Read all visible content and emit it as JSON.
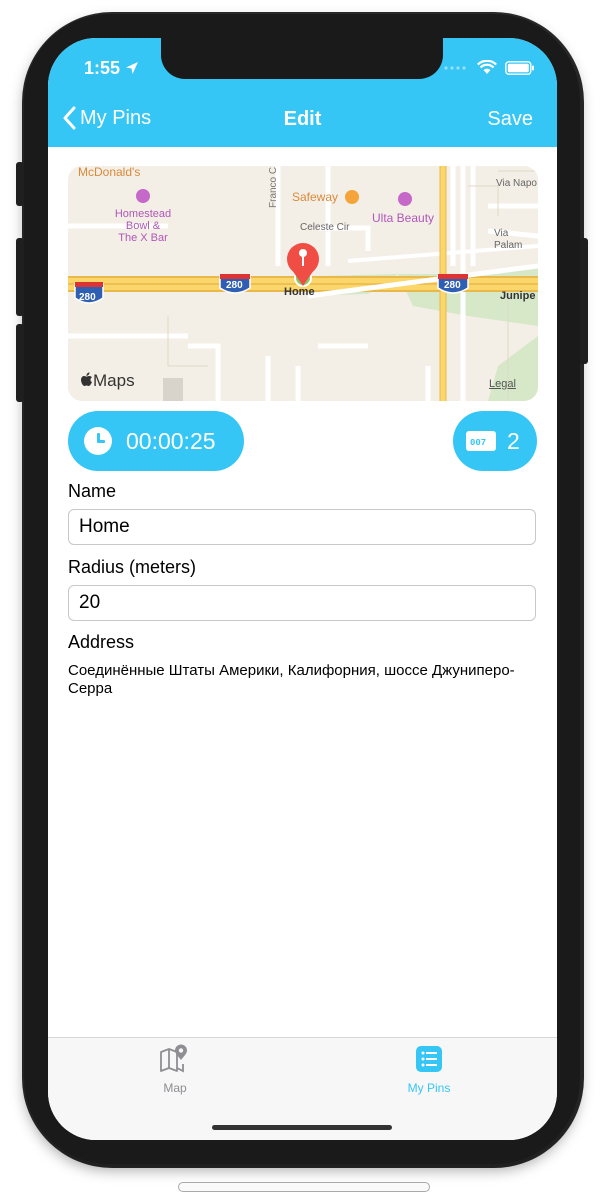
{
  "status": {
    "time": "1:55"
  },
  "nav": {
    "back_label": "My Pins",
    "title": "Edit",
    "save_label": "Save"
  },
  "map": {
    "labels": {
      "mcdonalds": "McDonald's",
      "homestead_1": "Homestead",
      "homestead_2": "Bowl &",
      "homestead_3": "The X Bar",
      "franco": "Franco C",
      "safeway": "Safeway",
      "ulta": "Ulta Beauty",
      "celeste": "Celeste Cir",
      "via_napo": "Via Napo",
      "via_palam": "Via Palam",
      "home": "Home",
      "junipe": "Junipe",
      "shield_280": "280",
      "maps_logo": "Maps",
      "legal": "Legal"
    }
  },
  "controls": {
    "timer": "00:00:25",
    "count": "2"
  },
  "form": {
    "name_label": "Name",
    "name_value": "Home",
    "radius_label": "Radius (meters)",
    "radius_value": "20",
    "address_label": "Address",
    "address_value": "Соединённые Штаты Америки, Калифорния, шоссе Джуниперо-Серра"
  },
  "tabs": [
    {
      "label": "Map",
      "icon": "map-pin-icon",
      "active": false
    },
    {
      "label": "My Pins",
      "icon": "list-icon",
      "active": true
    }
  ],
  "colors": {
    "accent": "#35c6f5",
    "inactive": "#8e8e93",
    "pin": "#f04e45"
  }
}
